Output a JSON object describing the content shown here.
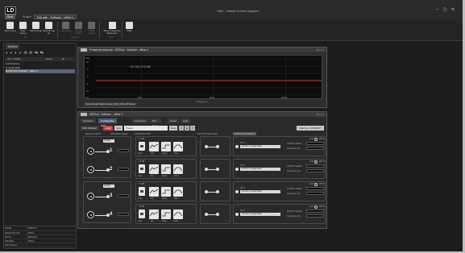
{
  "app": {
    "logo": "LD",
    "title": "VSD - Online Control System"
  },
  "menu_tabs": [
    "Start",
    "Project",
    "Edit with - Software - offline 1"
  ],
  "ribbon": {
    "buttons": [
      {
        "label": "New Group",
        "icon": "new-group-icon"
      },
      {
        "label": "Open Group",
        "icon": "open-folder-icon"
      },
      {
        "label": "Save Group",
        "icon": "save-icon"
      },
      {
        "label": "Save Group As",
        "icon": "save-as-icon"
      },
      {
        "label": "Link Group",
        "icon": "link-icon"
      },
      {
        "label": "Unlink Group",
        "icon": "unlink-icon"
      },
      {
        "label": "Unlink Group",
        "icon": "unlink-icon"
      },
      {
        "label": "Show Frequency Response",
        "icon": "graph-icon"
      },
      {
        "label": "Mute",
        "icon": "mute-icon"
      }
    ],
    "groups": [
      "File",
      "Grouping",
      "Tools"
    ]
  },
  "left_panel": {
    "tab": "Devices",
    "toolbar": "◐ ◐ ◐ ◐ ⟲ ⟳ ⇆ ⇆",
    "columns": [
      "Item / Model",
      "Name",
      "ID"
    ],
    "tree": [
      {
        "label": "▾ All Devices",
        "selected": false
      },
      {
        "label": "  ▾ Unallocated",
        "selected": false
      },
      {
        "label": "    ■ DSP 4x4    Software - offline 1",
        "selected": true
      }
    ],
    "properties": [
      [
        "Model",
        "DSP4x4"
      ],
      [
        "Serial Number",
        "offline"
      ],
      [
        "Name",
        "Software"
      ],
      [
        "Interface",
        "offline"
      ],
      [
        "FW Version",
        ""
      ]
    ]
  },
  "freq_window": {
    "title": "Frequency response - DSP4x4 - Software - offline 1",
    "controls": "▾ ▢ ✕",
    "readout": "81.95 | 0.0 dB",
    "y_axis_top": "Mag",
    "y_ticks": [
      "10",
      "5",
      "0",
      "-5",
      "-10",
      "-15"
    ],
    "x_ticks": [
      "100",
      "1000",
      "10000"
    ],
    "x_label": "Frequency",
    "curve_info": "Open Control Sight Center | Filter CPA & Iff button"
  },
  "dsp_window": {
    "title": "DSP4x4 - Software - offline 1",
    "tabs": [
      "Hardware",
      "Loudspeaker DSP",
      "Crossover",
      "Mix / Matrix",
      "Setup",
      "Help"
    ],
    "preset": {
      "label": "DSP PRESET",
      "button_a": "Load",
      "button_b": "Save",
      "field": "Preset",
      "save_btn": "Save",
      "action": "RECALL CURRENT"
    },
    "col_heads": [
      "ANALOG INPUT",
      "GROUND LEVEL",
      "CHANNEL DSP",
      "OUTPUT ROUTING",
      "SPEAKER PRESET"
    ],
    "input_sel": "Analog",
    "input_level": "0.0 dB",
    "channels": [
      {
        "num": "1",
        "out_num": "1",
        "gain": "0.0 dB",
        "delay": "0.00",
        "spk": "CH 1",
        "preset": "--PLUG (1 Single Pair)",
        "output_level": "OUTPUT LEVEL",
        "impedance": "Impedance (Ω)"
      },
      {
        "num": "2",
        "out_num": "2",
        "gain": "0.0 dB",
        "delay": "0.00",
        "spk": "CH 2",
        "preset": "--PLUG (1 Single Pair)",
        "output_level": "OUTPUT LEVEL",
        "impedance": "Impedance (Ω)"
      },
      {
        "num": "3",
        "out_num": "3",
        "gain": "0.0 dB",
        "delay": "0.00",
        "spk": "CH 3",
        "preset": "--PLUG (1 Single Pair)",
        "output_level": "OUTPUT LEVEL",
        "impedance": "Impedance (Ω)"
      },
      {
        "num": "4",
        "out_num": "4",
        "gain": "0.0 dB",
        "delay": "0.00",
        "spk": "CH 4",
        "preset": "--PLUG (1 Single Pair)",
        "output_level": "OUTPUT LEVEL",
        "impedance": "Impedance (Ω)"
      }
    ],
    "block_labels": [
      "Gain",
      "EQ",
      "Delay",
      "Filter"
    ],
    "clip": "CLIP",
    "prot": "PROT"
  }
}
